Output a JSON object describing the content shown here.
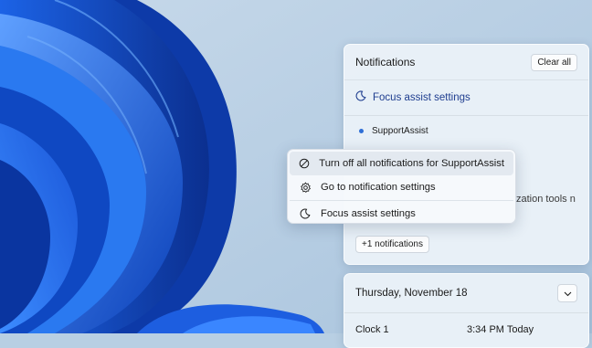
{
  "notifications": {
    "title": "Notifications",
    "clear_all": "Clear all",
    "focus_assist": "Focus assist settings",
    "app_name": "SupportAssist",
    "snippet": "zation tools n",
    "more": "+1 notifications"
  },
  "context_menu": {
    "items": [
      {
        "label": "Turn off all notifications for SupportAssist",
        "icon": "block-icon"
      },
      {
        "label": "Go to notification settings",
        "icon": "gear-icon"
      },
      {
        "label": "Focus assist settings",
        "icon": "moon-icon"
      }
    ]
  },
  "calendar": {
    "date": "Thursday, November 18",
    "clock_label": "Clock 1",
    "clock_time": "3:34 PM Today"
  },
  "colors": {
    "accent": "#1e3d8f",
    "wallpaper_blue": "#1f5fd8",
    "wallpaper_bg": "#b8cfe3"
  }
}
